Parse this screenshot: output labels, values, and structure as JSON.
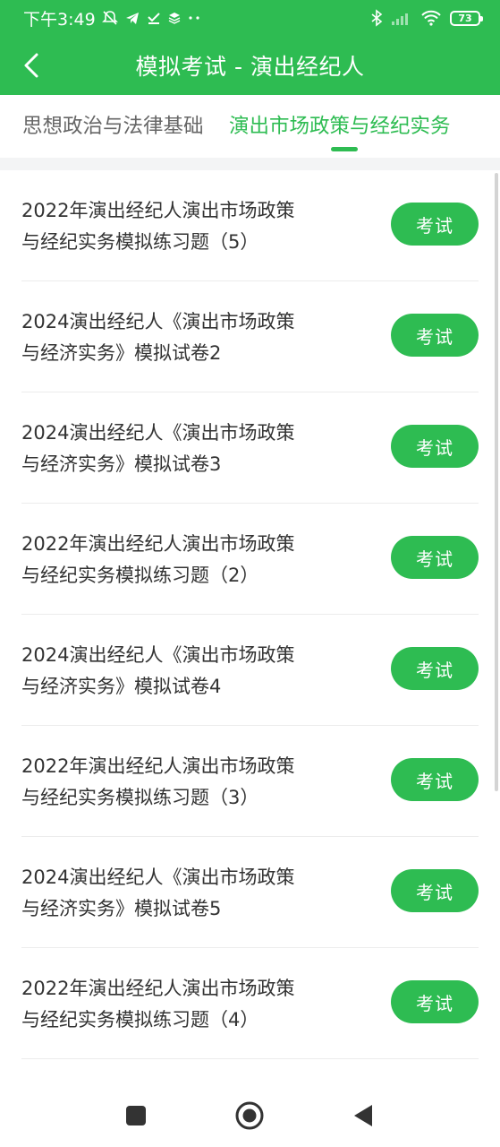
{
  "status_bar": {
    "time": "下午3:49",
    "battery": "73",
    "icons_left": [
      "muted-bell-icon",
      "telegram-icon",
      "download-done-icon",
      "stack-icon",
      "more-dots-icon"
    ],
    "icons_right": [
      "bluetooth-icon",
      "signal-icon",
      "wifi-icon",
      "battery-icon"
    ]
  },
  "app_bar": {
    "title": "模拟考试 - 演出经纪人"
  },
  "tabs": [
    {
      "label": "思想政治与法律基础",
      "active": false
    },
    {
      "label": "演出市场政策与经纪实务",
      "active": true
    }
  ],
  "items": [
    {
      "title": "2022年演出经纪人演出市场政策与经纪实务模拟练习题（5）",
      "button": "考试"
    },
    {
      "title": "2024演出经纪人《演出市场政策与经济实务》模拟试卷2",
      "button": "考试"
    },
    {
      "title": "2024演出经纪人《演出市场政策与经济实务》模拟试卷3",
      "button": "考试"
    },
    {
      "title": "2022年演出经纪人演出市场政策与经纪实务模拟练习题（2）",
      "button": "考试"
    },
    {
      "title": "2024演出经纪人《演出市场政策与经济实务》模拟试卷4",
      "button": "考试"
    },
    {
      "title": "2022年演出经纪人演出市场政策与经纪实务模拟练习题（3）",
      "button": "考试"
    },
    {
      "title": "2024演出经纪人《演出市场政策与经济实务》模拟试卷5",
      "button": "考试"
    },
    {
      "title": "2022年演出经纪人演出市场政策与经纪实务模拟练习题（4）",
      "button": "考试"
    }
  ],
  "colors": {
    "accent": "#2ebc52",
    "text": "#333333",
    "tab_inactive": "#666666"
  }
}
